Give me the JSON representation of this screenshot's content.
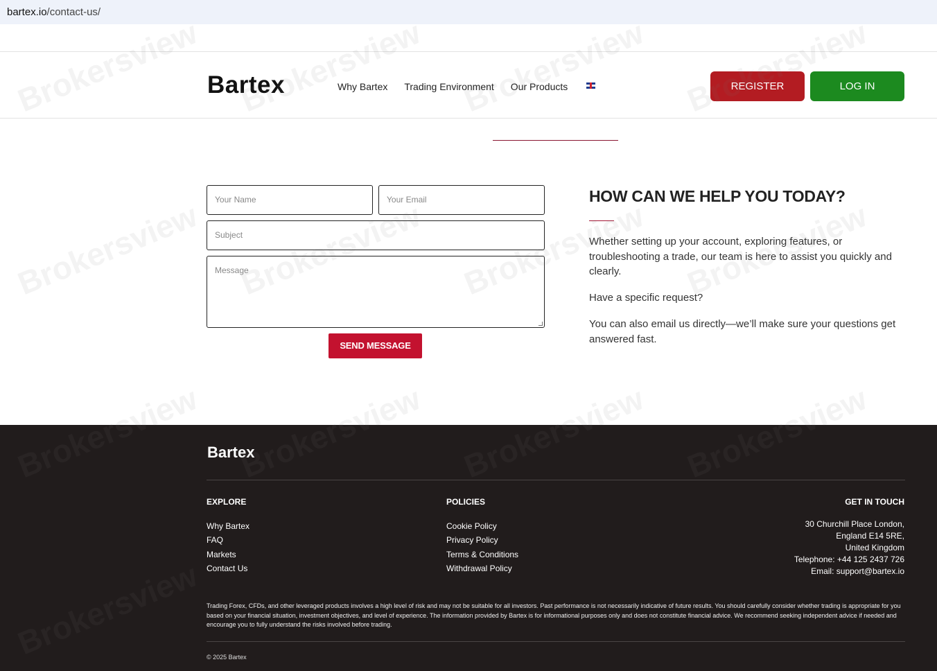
{
  "browser": {
    "url_domain": "bartex.io",
    "url_path": "/contact-us/"
  },
  "header": {
    "logo": "Bartex",
    "nav": [
      {
        "label": "Why Bartex"
      },
      {
        "label": "Trading Environment"
      },
      {
        "label": "Our Products"
      }
    ],
    "language_icon": "uk-flag-icon",
    "register_label": "REGISTER",
    "login_label": "LOG IN",
    "colors": {
      "register": "#b31c22",
      "login": "#1c8a1f"
    }
  },
  "form": {
    "name_placeholder": "Your Name",
    "email_placeholder": "Your Email",
    "subject_placeholder": "Subject",
    "message_placeholder": "Message",
    "send_label": "SEND MESSAGE",
    "send_color": "#c3122f"
  },
  "help": {
    "title": "HOW CAN WE HELP YOU TODAY?",
    "paragraphs": [
      "Whether setting up your account, exploring features, or troubleshooting a trade, our team is here to assist you quickly and clearly.",
      "Have a specific request?",
      "You can also email us directly—we’ll make sure your questions get answered fast."
    ]
  },
  "footer": {
    "logo": "Bartex",
    "explore": {
      "heading": "EXPLORE",
      "items": [
        "Why Bartex",
        "FAQ",
        "Markets",
        "Contact Us"
      ]
    },
    "policies": {
      "heading": "POLICIES",
      "items": [
        "Cookie Policy",
        "Privacy Policy",
        "Terms & Conditions",
        "Withdrawal Policy"
      ]
    },
    "contact": {
      "heading": "GET IN TOUCH",
      "lines": [
        "30 Churchill Place London,",
        "England E14 5RE,",
        "United Kingdom",
        "Telephone: +44 125 2437 726",
        "Email: support@bartex.io"
      ]
    },
    "disclaimer": "Trading Forex, CFDs, and other leveraged products involves a high level of risk and may not be suitable for all investors. Past performance is not necessarily indicative of future results. You should carefully consider whether trading is appropriate for you based on your financial situation, investment objectives, and level of experience. The information provided by Bartex is for informational purposes only and does not constitute financial advice. We recommend seeking independent advice if needed and encourage you to fully understand the risks involved before trading.",
    "copyright": "© 2025 Bartex",
    "background": "#211c1c"
  },
  "watermark": "Brokersview"
}
